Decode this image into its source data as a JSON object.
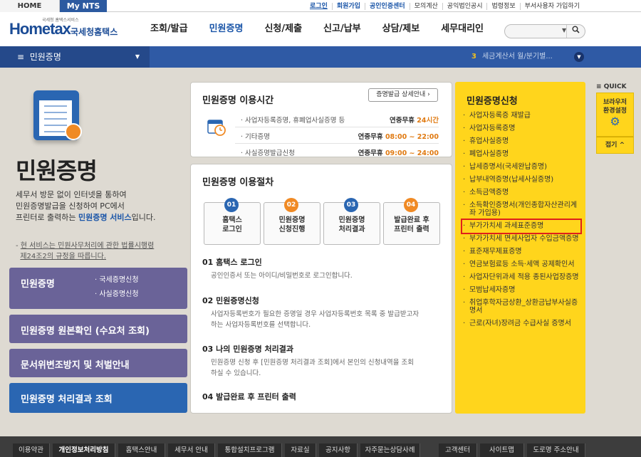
{
  "topbar": {
    "home": "HOME",
    "mynts": "My NTS",
    "util": [
      "로그인",
      "회원가입",
      "공인인증센터",
      "모의계산",
      "공익법인공시",
      "법령정보",
      "부서사용자 가입하기"
    ]
  },
  "header": {
    "logo_small": "국세청 홈택스서비스",
    "logo_main": "Hometax",
    "logo_sub": "국세청홈택스",
    "gnb": [
      "조회/발급",
      "민원증명",
      "신청/제출",
      "신고/납부",
      "상담/제보",
      "세무대리인"
    ],
    "search_icon": "magnifier-icon"
  },
  "navbar": {
    "menu_label": "민원증명",
    "notice_num": "3",
    "notice_text": "세금계산서 월/분기별..."
  },
  "left": {
    "title": "민원증명",
    "desc_1": "세무서 방문 없이 인터넷을 통하여",
    "desc_2": "민원증명발급을 신청하여 PC에서",
    "desc_3": "프린터로 출력하는",
    "desc_hl": "민원증명 서비스",
    "desc_4": "입니다.",
    "note_1": "현 서비스는 민원사무처리에 관한 법률시행령",
    "note_2": "제24조2의 규정을 따릅니다.",
    "menu": [
      {
        "label": "민원증명",
        "subs": [
          "국세증명신청",
          "사실증명신청"
        ]
      },
      {
        "label": "민원증명 원본확인 (수요처 조회)"
      },
      {
        "label": "문서위변조방지 및 처벌안내"
      },
      {
        "label": "민원증명 처리결과 조회"
      }
    ]
  },
  "time": {
    "title": "민원증명 이용시간",
    "guide_btn": "증명발급 상세안내",
    "rows": [
      {
        "name": "사업자등록증명, 휴폐업사실증명 등",
        "prefix": "연중무휴",
        "value": "24시간"
      },
      {
        "name": "기타증명",
        "prefix": "연중무휴",
        "value": "08:00 ~ 22:00"
      },
      {
        "name": "사실증명발급신청",
        "prefix": "연중무휴",
        "value": "09:00 ~ 24:00"
      }
    ]
  },
  "procedure": {
    "title": "민원증명 이용절차",
    "steps": [
      {
        "num": "01",
        "l1": "홈택스",
        "l2": "로그인",
        "color": "#2a66b2"
      },
      {
        "num": "02",
        "l1": "민원증명",
        "l2": "신청진행",
        "color": "#f08a24"
      },
      {
        "num": "03",
        "l1": "민원증명",
        "l2": "처리결과",
        "color": "#2a66b2"
      },
      {
        "num": "04",
        "l1": "발급완료 후",
        "l2": "프린터 출력",
        "color": "#f08a24"
      }
    ],
    "sections": [
      {
        "h": "01 홈택스 로그인",
        "d1": "공인인증서 또는 아이디/비밀번호로 로그인합니다.",
        "d2": ""
      },
      {
        "h": "02 민원증명신청",
        "d1": "사업자등록번호가 필요한 증명일 경우 사업자등록번호 목록 중 발급받고자",
        "d2": "하는 사업자등록번호를 선택합니다."
      },
      {
        "h": "03 나의 민원증명 처리결과",
        "d1": "민원증명 신청 후 [민원증명 처리결과 조회]에서 본인의 신청내역을 조회",
        "d2": "하실 수 있습니다."
      },
      {
        "h": "04 발급완료 후 프린터 출력",
        "d1": "",
        "d2": ""
      }
    ]
  },
  "apply": {
    "title": "민원증명신청",
    "items": [
      "사업자등록증 재발급",
      "사업자등록증명",
      "휴업사실증명",
      "폐업사실증명",
      "납세증명서(국세완납증명)",
      "납부내역증명(납세사실증명)",
      "소득금액증명",
      "소득확인증명서(개인종합자산관리계좌 가입용)",
      "부가가치세 과세표준증명",
      "부가가치세 면세사업자 수입금액증명",
      "표준재무제표증명",
      "연금보험료등 소득·세액 공제확인서",
      "사업자단위과세 적용 종된사업장증명",
      "모범납세자증명",
      "취업후학자금상환_상환금납부사실증명서",
      "근로(자녀)장려금 수급사실 증명서"
    ],
    "selected_index": 8,
    "highlight_color": "#e0201a"
  },
  "quick": {
    "label": "QUICK",
    "btn_1": "브라우저",
    "btn_2": "환경설정",
    "gear_icon": "gear-icon",
    "close": "접기"
  },
  "footer": {
    "links": [
      "이용약관",
      "개인정보처리방침",
      "홈택스안내",
      "세무서 안내",
      "통합설치프로그램",
      "자료실",
      "공지사항",
      "자주묻는상담사례",
      "고객센터",
      "사이트맵",
      "도로명 주소안내"
    ]
  },
  "colors": {
    "accent": "#2f5aa5",
    "menu": "#6a6398",
    "apply_bg": "#ffd51c",
    "orange": "#e07a12"
  }
}
